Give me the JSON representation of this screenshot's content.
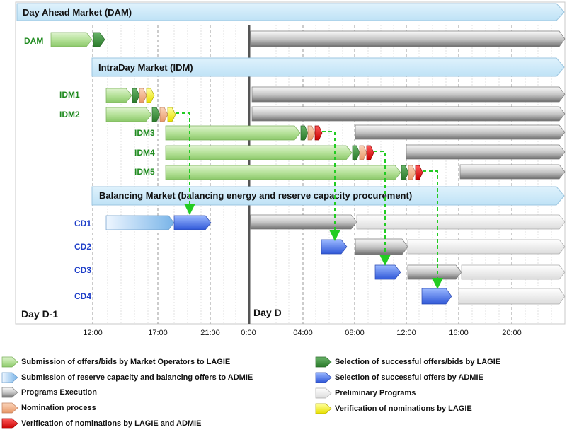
{
  "markets": {
    "dam": "Day Ahead Market (DAM)",
    "idm": "IntraDay Market (IDM)",
    "bm": "Balancing Market (balancing energy and reserve capacity procurement)"
  },
  "rows": {
    "dam": "DAM",
    "idm1": "IDM1",
    "idm2": "IDM2",
    "idm3": "IDM3",
    "idm4": "IDM4",
    "idm5": "IDM5",
    "cd1": "CD1",
    "cd2": "CD2",
    "cd3": "CD3",
    "cd4": "CD4"
  },
  "days": {
    "d_minus_1": "Day D-1",
    "d": "Day D"
  },
  "ticks": {
    "t1200a": "12:00",
    "t1700": "17:00",
    "t2100": "21:00",
    "t0000": "0:00",
    "t0400": "04:00",
    "t0800": "08:00",
    "t1200b": "12:00",
    "t1600": "16:00",
    "t2000": "20:00"
  },
  "legend": {
    "submission_offers_lagie": "Submission of offers/bids by Market Operators to LAGIE",
    "submission_reserve_admie": "Submission of reserve capacity and balancing offers to ADMIE",
    "programs_execution": "Programs Execution",
    "nomination_process": "Nomination process",
    "verification_lagie_admie": "Verification of nominations by LAGIE and ADMIE",
    "selection_lagie": "Selection of successful offers/bids by LAGIE",
    "selection_admie": "Selection of successful offers by ADMIE",
    "preliminary_programs": "Preliminary Programs",
    "verification_lagie": "Verification of nominations by LAGIE"
  },
  "colors": {
    "light_green": "#a8d88a",
    "dark_green": "#3a8a3a",
    "blue": "#4a78e8",
    "light_blue": "#a8d0f0",
    "gray": "#8a8a8a",
    "light_gray": "#f0f0f0",
    "salmon": "#f4b48a",
    "red": "#e81010",
    "yellow": "#f8f000",
    "label_green": "#1e8a1e",
    "label_blue": "#1e3ec8",
    "dashed_green": "#22cc22",
    "header_fill": "#cce8f8"
  }
}
